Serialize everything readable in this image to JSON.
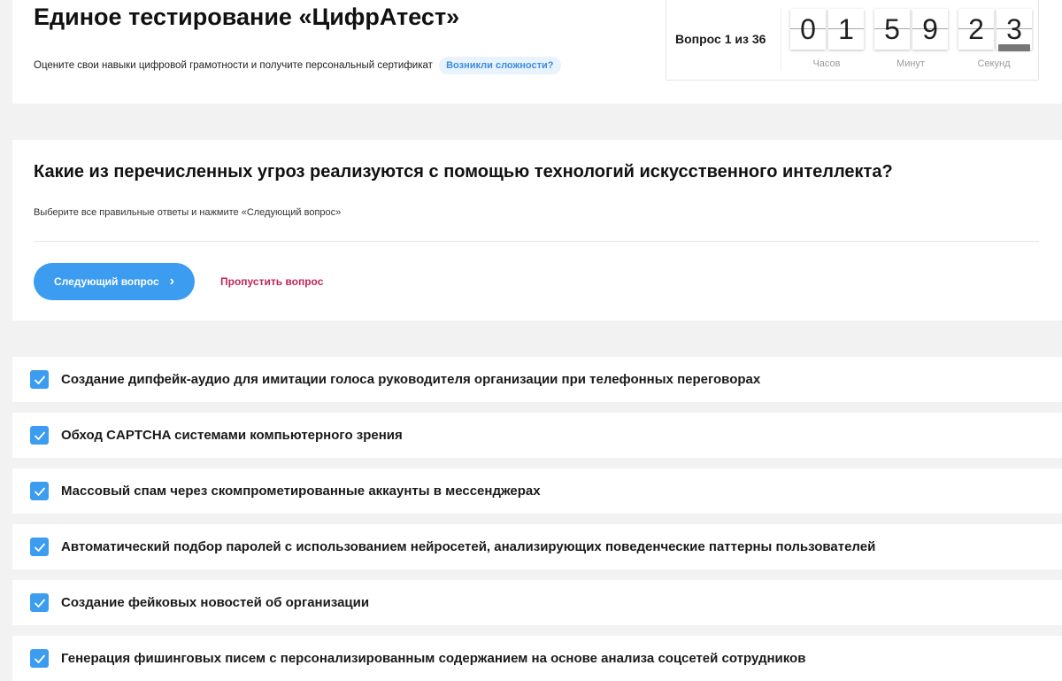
{
  "header": {
    "title": "Единое тестирование «ЦифрАтест»",
    "subtitle": "Оцените свои навыки цифровой грамотности и получите персональный сертификат",
    "help_link": "Возникли сложности?"
  },
  "timer": {
    "question_counter": "Вопрос 1 из 36",
    "digits": [
      "0",
      "1",
      "5",
      "9",
      "2",
      "3"
    ],
    "units": [
      "Часов",
      "Минут",
      "Секунд"
    ]
  },
  "question": {
    "title": "Какие из перечисленных угроз реализуются с помощью технологий искусственного интеллекта?",
    "hint": "Выберите все правильные ответы и нажмите «Следующий вопрос»",
    "next_label": "Следующий вопрос",
    "skip_label": "Пропустить вопрос"
  },
  "answers": [
    {
      "text": "Создание дипфейк-аудио для имитации голоса руководителя организации при телефонных переговорах",
      "checked": true
    },
    {
      "text": "Обход CAPTCHA системами компьютерного зрения",
      "checked": true
    },
    {
      "text": "Массовый спам через скомпрометированные аккаунты в мессенджерах",
      "checked": true
    },
    {
      "text": "Автоматический подбор паролей с использованием нейросетей, анализирующих поведенческие паттерны пользователей",
      "checked": true
    },
    {
      "text": "Создание фейковых новостей об организации",
      "checked": true
    },
    {
      "text": "Генерация фишинговых писем с персонализированным содержанием на основе анализа соцсетей сотрудников",
      "checked": true
    }
  ],
  "colors": {
    "accent": "#3b9cf0",
    "skip": "#c0265a",
    "help_bg": "#e8f3fd"
  }
}
